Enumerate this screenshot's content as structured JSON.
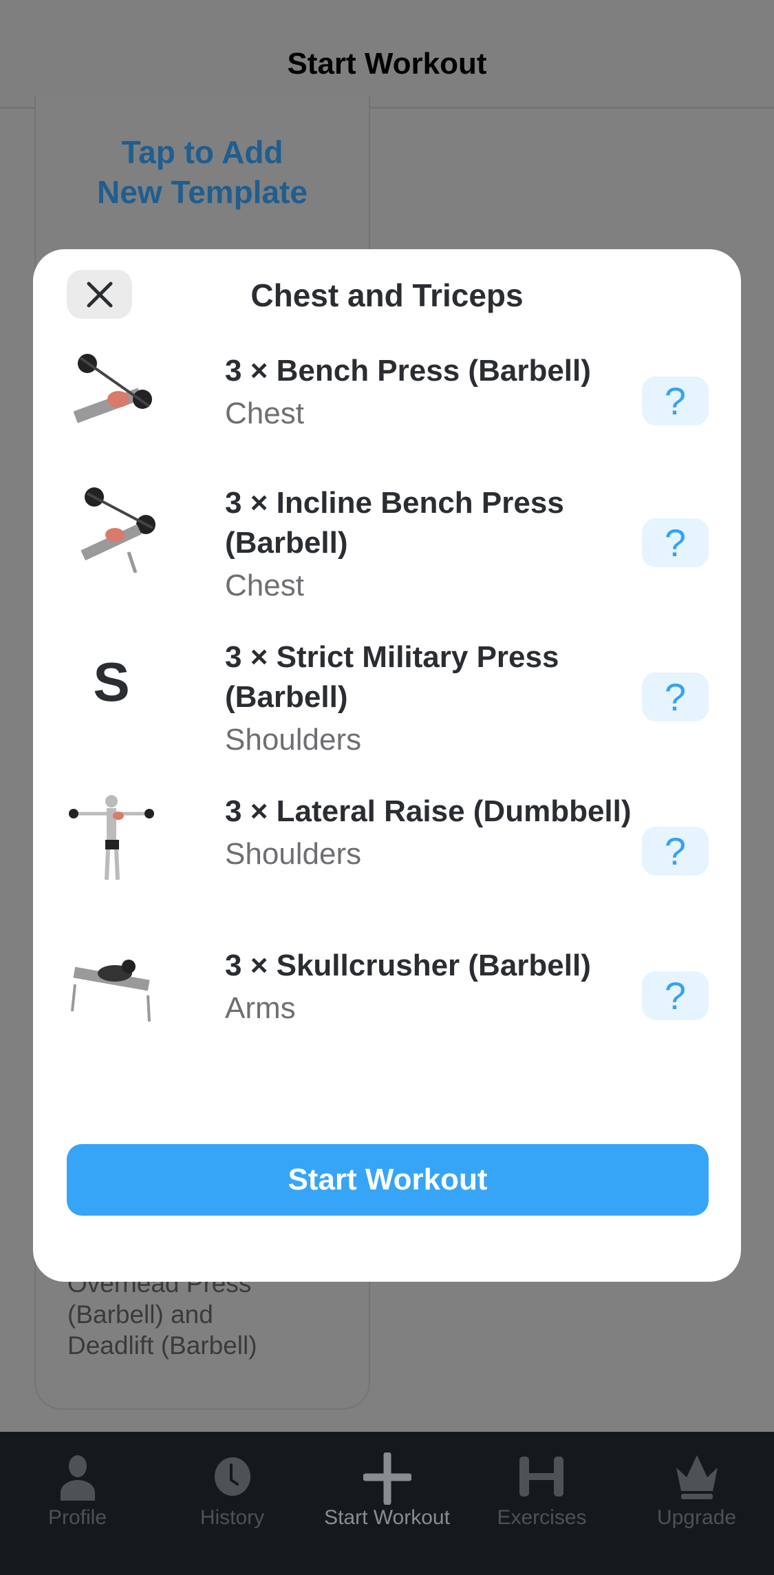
{
  "header": {
    "title": "Start Workout"
  },
  "background": {
    "add_template": "Tap to Add\nNew Template",
    "template_desc": "Overhead Press\n(Barbell) and\nDeadlift (Barbell)"
  },
  "modal": {
    "title": "Chest and Triceps",
    "close_icon": "close-icon",
    "exercises": [
      {
        "name": "3 × Bench Press (Barbell)",
        "muscle": "Chest",
        "thumb": "image"
      },
      {
        "name": "3 × Incline Bench Press (Barbell)",
        "muscle": "Chest",
        "thumb": "image"
      },
      {
        "name": "3 × Strict Military Press (Barbell)",
        "muscle": "Shoulders",
        "thumb": "S"
      },
      {
        "name": "3 × Lateral Raise (Dumbbell)",
        "muscle": "Shoulders",
        "thumb": "image"
      },
      {
        "name": "3 × Skullcrusher (Barbell)",
        "muscle": "Arms",
        "thumb": "image"
      }
    ],
    "help_label": "?",
    "start_button": "Start Workout"
  },
  "tabs": [
    {
      "label": "Profile",
      "icon": "person-icon"
    },
    {
      "label": "History",
      "icon": "clock-icon"
    },
    {
      "label": "Start Workout",
      "icon": "plus-icon",
      "active": true
    },
    {
      "label": "Exercises",
      "icon": "dumbbell-icon"
    },
    {
      "label": "Upgrade",
      "icon": "crown-icon"
    }
  ],
  "colors": {
    "accent": "#36a5f7",
    "help_bg": "#e6f4fe",
    "tabbar": "#15191c"
  }
}
